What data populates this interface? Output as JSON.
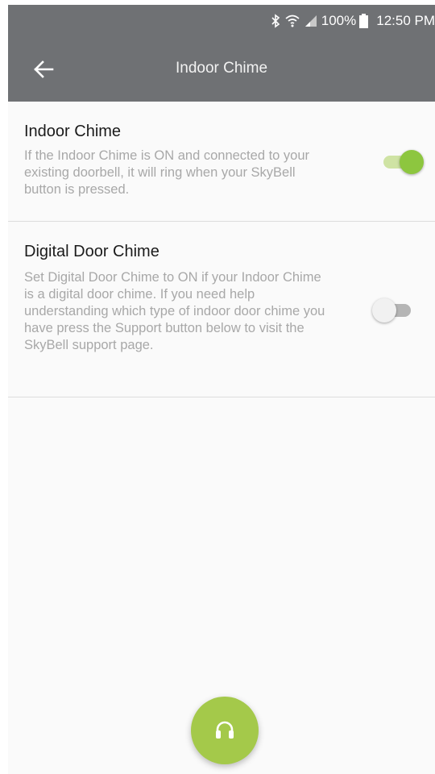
{
  "status_bar": {
    "icons": [
      "bluetooth-icon",
      "wifi-icon",
      "signal-icon",
      "battery-icon"
    ],
    "battery": "100%",
    "time": "12:50 PM"
  },
  "app_bar": {
    "back_icon": "arrow-left-icon",
    "title": "Indoor Chime"
  },
  "settings": [
    {
      "title": "Indoor Chime",
      "description": "If the Indoor Chime is ON and connected to your existing doorbell, it will ring when your SkyBell button is pressed.",
      "enabled": true
    },
    {
      "title": "Digital Door Chime",
      "description": "Set Digital Door Chime to ON if your Indoor Chime is a digital door chime. If you need help understanding which type of indoor door chime you have press the Support button below to visit the SkyBell support page.",
      "enabled": false
    }
  ],
  "support_fab": {
    "icon": "headset-icon"
  },
  "colors": {
    "app_bar": "#6f7174",
    "accent": "#8dc63f",
    "fab": "#a4c94a",
    "background": "#fafafa"
  }
}
